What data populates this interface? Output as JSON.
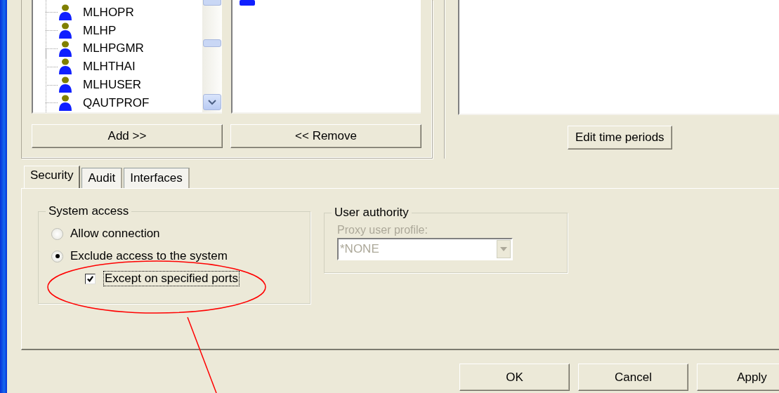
{
  "users_list": {
    "items": [
      "MLHOPR",
      "MLHP",
      "MLHPGMR",
      "MLHTHAI",
      "MLHUSER",
      "QAUTPROF"
    ]
  },
  "add_button": "Add >>",
  "remove_button": "<< Remove",
  "edit_time_periods_button": "Edit time periods",
  "tabs": [
    {
      "label": "Security",
      "selected": true
    },
    {
      "label": "Audit",
      "selected": false
    },
    {
      "label": "Interfaces",
      "selected": false
    }
  ],
  "system_access": {
    "title": "System access",
    "options": [
      {
        "label": "Allow connection",
        "selected": false
      },
      {
        "label": "Exclude access to the system",
        "selected": true
      }
    ],
    "except_ports": {
      "label": "Except on specified ports",
      "checked": true
    }
  },
  "user_authority": {
    "title": "User authority",
    "proxy_label": "Proxy user profile:",
    "proxy_value": "*NONE",
    "disabled": true
  },
  "buttons": [
    "OK",
    "Cancel",
    "Apply"
  ]
}
